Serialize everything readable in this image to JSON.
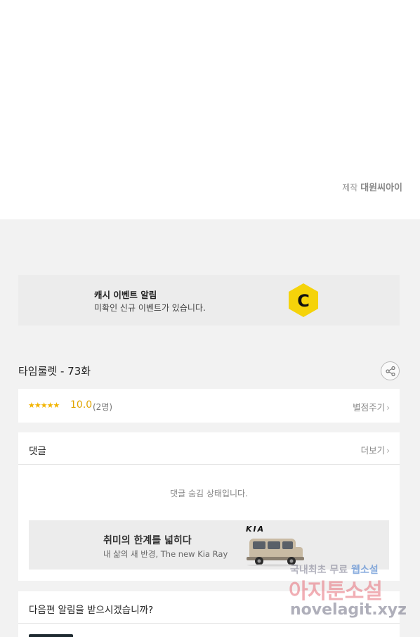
{
  "credit": {
    "label": "제작",
    "studio": "대원씨아이"
  },
  "cash_event": {
    "title": "캐시 이벤트 알림",
    "subtitle": "미확인 신규 이벤트가 있습니다.",
    "logo_letter": "C",
    "logo_color": "#f5d30a"
  },
  "episode": {
    "title": "타임룰렛 - 73화",
    "share_icon": "share-icon"
  },
  "rating": {
    "stars": "★★★★★",
    "score": "10.0",
    "count": "(2명)",
    "rate_label": "별점주기"
  },
  "comments": {
    "title": "댓글",
    "more_label": "더보기",
    "hidden_text": "댓글 숨김 상태입니다."
  },
  "ad": {
    "headline": "취미의 한계를 넓히다",
    "subline": "내 삶의 새 반경, The new Kia Ray",
    "brand": "KIA"
  },
  "notify": {
    "title": "다음편 알림을 받으시겠습니까?"
  },
  "watermark": {
    "line1_prefix": "국내최초 무료",
    "line1_highlight": "웹소설",
    "line2": "아지툰소설",
    "line3": "novelagit.xyz"
  },
  "colors": {
    "accent": "#f2b400",
    "background": "#f2f2f2"
  }
}
